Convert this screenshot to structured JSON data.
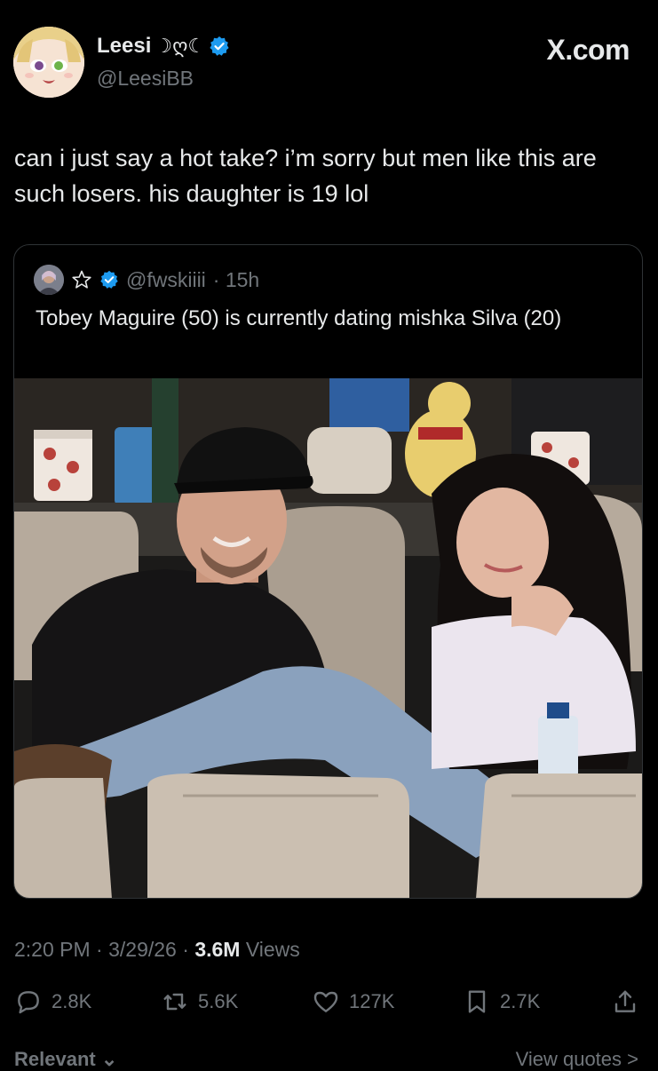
{
  "author": {
    "name": "Leesi",
    "name_decoration": "☽ღ☾",
    "handle": "@LeesiBB",
    "verified": true
  },
  "brand": "X.com",
  "tweet": {
    "text": "can i just say a hot take? i’m sorry but men like this are such losers. his daughter is 19 lol"
  },
  "quoted": {
    "handle": "@fwskiiii",
    "time": "· 15h",
    "text": "Tobey Maguire (50) is currently dating mishka Silva (20)"
  },
  "meta": {
    "time": "2:20 PM",
    "date": "3/29/26",
    "views_count": "3.6M",
    "views_label": "Views",
    "sep": "·"
  },
  "actions": {
    "replies": "2.8K",
    "reposts": "5.6K",
    "likes": "127K",
    "bookmarks": "2.7K"
  },
  "footer": {
    "left": "Relevant ⌄",
    "right": "View quotes >"
  },
  "colors": {
    "background": "#000000",
    "text": "#e7e9ea",
    "muted": "#71767b",
    "verified": "#1d9bf0",
    "border": "#2f3336"
  }
}
